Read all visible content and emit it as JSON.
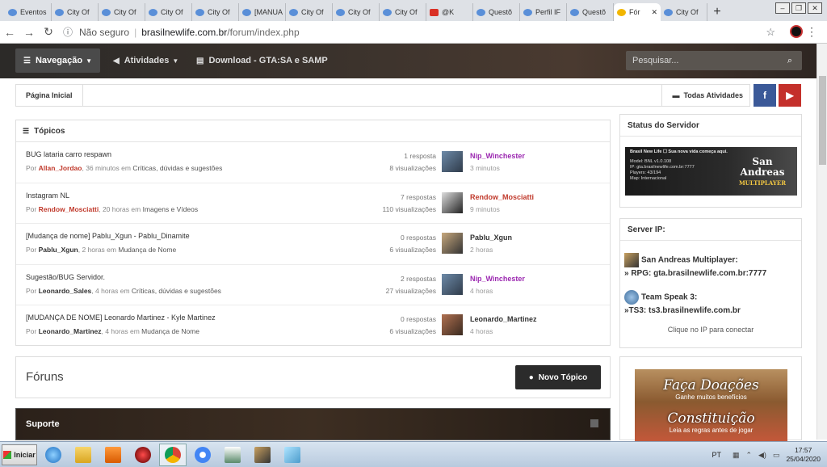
{
  "browser": {
    "tabs": [
      {
        "label": "Eventos",
        "icon": "chat-icon"
      },
      {
        "label": "City Of",
        "icon": "chat-icon"
      },
      {
        "label": "City Of",
        "icon": "chat-icon"
      },
      {
        "label": "City Of",
        "icon": "chat-icon"
      },
      {
        "label": "City Of",
        "icon": "chat-icon"
      },
      {
        "label": "[MANUA",
        "icon": "chat-icon"
      },
      {
        "label": "City Of",
        "icon": "chat-icon"
      },
      {
        "label": "City Of",
        "icon": "chat-icon"
      },
      {
        "label": "City Of",
        "icon": "chat-icon"
      },
      {
        "label": "@K",
        "icon": "app-icon"
      },
      {
        "label": "Questõ",
        "icon": "chat-icon"
      },
      {
        "label": "Perfil IF",
        "icon": "chat-icon"
      },
      {
        "label": "Questõ",
        "icon": "chat-icon"
      },
      {
        "label": "Fór",
        "icon": "forum-icon"
      },
      {
        "label": "City Of",
        "icon": "chat-icon"
      }
    ],
    "new_tab": "+",
    "security_label": "Não seguro",
    "url_host": "brasilnewlife.com.br",
    "url_path": "/forum/index.php"
  },
  "site_nav": {
    "items": [
      {
        "label": "Navegação",
        "icon": "menu-icon"
      },
      {
        "label": "Atividades",
        "icon": "megaphone-icon"
      },
      {
        "label": "Download - GTA:SA e SAMP",
        "icon": "document-icon"
      }
    ],
    "search_placeholder": "Pesquisar..."
  },
  "breadcrumb": {
    "home": "Página Inicial",
    "all_activities": "Todas Atividades"
  },
  "social": {
    "facebook": "f",
    "youtube": "▶"
  },
  "topics": {
    "title": "Tópicos",
    "rows": [
      {
        "title": "BUG lataria carro respawn",
        "by": "Por",
        "author": "Allan_Jordao",
        "time": ", 36 minutos em",
        "category": "Críticas, dúvidas e sugestões",
        "replies": "1 resposta",
        "views": "8 visualizações",
        "last_user": "Nip_Winchester",
        "last_time": "3 minutos"
      },
      {
        "title": "Instagram NL",
        "by": "Por",
        "author": "Rendow_Mosciatti",
        "time": ", 20 horas em",
        "category": "Imagens e Vídeos",
        "replies": "7 respostas",
        "views": "110 visualizações",
        "last_user": "Rendow_Mosciatti",
        "last_time": "9 minutos"
      },
      {
        "title": "[Mudança de nome] Pablu_Xgun - Pablu_Dinamite",
        "by": "Por",
        "author": "Pablu_Xgun",
        "time": ", 2 horas em",
        "category": "Mudança de Nome",
        "replies": "0 respostas",
        "views": "6 visualizações",
        "last_user": "Pablu_Xgun",
        "last_time": "2 horas"
      },
      {
        "title": "Sugestão/BUG Servidor.",
        "by": "Por",
        "author": "Leonardo_Sales",
        "time": ", 4 horas em",
        "category": "Críticas, dúvidas e sugestões",
        "replies": "2 respostas",
        "views": "27 visualizações",
        "last_user": "Nip_Winchester",
        "last_time": "4 horas"
      },
      {
        "title": "[MUDANÇA DE NOME] Leonardo Martinez - Kyle Martinez",
        "by": "Por",
        "author": "Leonardo_Martinez",
        "time": ", 4 horas em",
        "category": "Mudança de Nome",
        "replies": "0 respostas",
        "views": "6 visualizações",
        "last_user": "Leonardo_Martinez",
        "last_time": "4 horas"
      }
    ]
  },
  "forums": {
    "title": "Fóruns",
    "new_topic": "Novo Tópico",
    "section": "Suporte"
  },
  "sidebar": {
    "status_title": "Status do Servidor",
    "banner": {
      "headline": "Brasil New Life ☐ Sua nova vida começa aqui.",
      "line1": "Model: BNL v1.0.108",
      "line2": "IP: gta.brasilnewlife.com.br:7777",
      "line3": "Players: 43/194",
      "line4": "Map: Internacional",
      "logo": "San Andreas",
      "logo_sub": "MULTIPLAYER"
    },
    "ip_title": "Server IP:",
    "samp_label": "San Andreas Multiplayer:",
    "samp_ip": "» RPG: gta.brasilnewlife.com.br:7777",
    "ts_label": "Team Speak 3:",
    "ts_ip": "»TS3: ts3.brasilnewlife.com.br",
    "ip_note": "Clique no IP para conectar",
    "donate_title": "Faça Doações",
    "donate_sub": "Ganhe muitos benefícios",
    "const_title": "Constituição",
    "const_sub": "Leia as regras antes de jogar"
  },
  "taskbar": {
    "start": "Iniciar",
    "lang": "PT",
    "time": "17:57",
    "date": "25/04/2020"
  }
}
